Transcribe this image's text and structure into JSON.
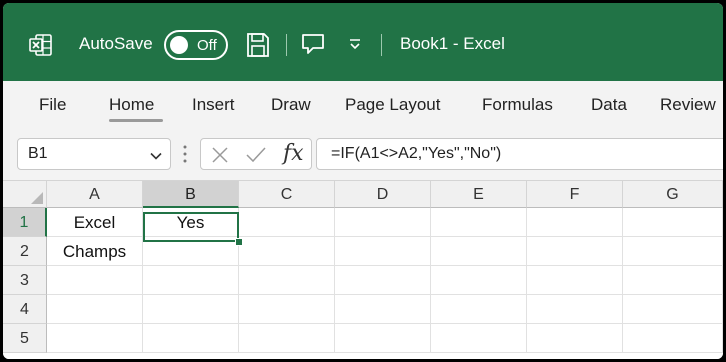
{
  "titlebar": {
    "autosave_label": "AutoSave",
    "autosave_state": "Off",
    "doc_title": "Book1 - Excel",
    "icons": [
      "excel-logo-icon",
      "save-icon",
      "touch-mode-icon",
      "customize-qat-icon"
    ]
  },
  "ribbon": {
    "tabs": [
      "File",
      "Home",
      "Insert",
      "Draw",
      "Page Layout",
      "Formulas",
      "Data",
      "Review"
    ],
    "active_tab": "Home"
  },
  "formula_bar": {
    "name_box": "B1",
    "fx_label": "fx",
    "formula": "=IF(A1<>A2,\"Yes\",\"No\")"
  },
  "grid": {
    "columns": [
      "A",
      "B",
      "C",
      "D",
      "E",
      "F",
      "G"
    ],
    "rows": [
      "1",
      "2",
      "3",
      "4",
      "5"
    ],
    "cells": {
      "A1": "Excel",
      "B1": "Yes",
      "A2": "Champs"
    },
    "active_cell": "B1"
  },
  "colors": {
    "accent": "#217346",
    "ribbon_bg": "#f3f3f3"
  }
}
